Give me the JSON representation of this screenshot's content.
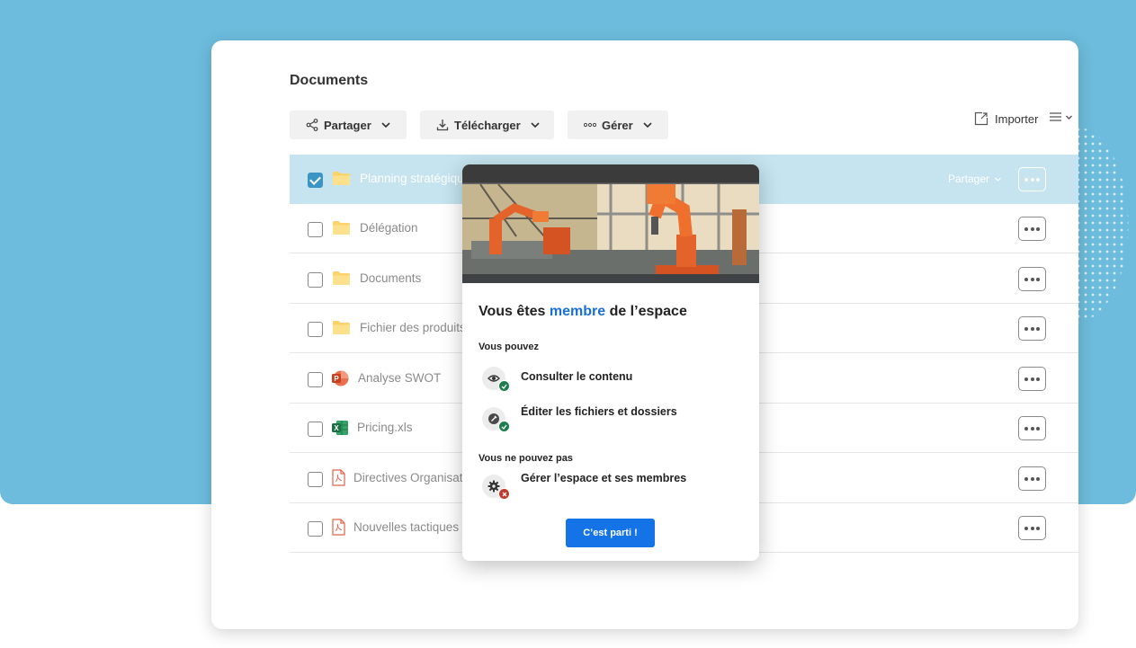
{
  "page": {
    "title": "Documents"
  },
  "toolbar": {
    "share_label": "Partager",
    "download_label": "Télécharger",
    "manage_label": "Gérer",
    "import_label": "Importer"
  },
  "files": [
    {
      "name": "Planning stratégique",
      "type": "folder",
      "selected": true,
      "row_action": "Partager"
    },
    {
      "name": "Délégation",
      "type": "folder",
      "selected": false
    },
    {
      "name": "Documents",
      "type": "folder",
      "selected": false
    },
    {
      "name": "Fichier des produits",
      "type": "folder",
      "selected": false
    },
    {
      "name": "Analyse SWOT",
      "type": "powerpoint",
      "selected": false
    },
    {
      "name": "Pricing.xls",
      "type": "excel",
      "selected": false
    },
    {
      "name": "Directives Organisat",
      "type": "pdf",
      "selected": false
    },
    {
      "name": "Nouvelles tactiques",
      "type": "pdf",
      "selected": false
    }
  ],
  "modal": {
    "title_prefix": "Vous êtes",
    "title_accent": "membre",
    "title_suffix": "de l’espace",
    "can_label": "Vous pouvez",
    "can": [
      {
        "label": "Consulter le contenu",
        "icon": "eye-icon",
        "status": "allowed"
      },
      {
        "label": "Éditer les fichiers et dossiers",
        "icon": "pencil-icon",
        "status": "allowed"
      }
    ],
    "cannot_label": "Vous ne pouvez pas",
    "cannot": [
      {
        "label": "Gérer l’espace et ses membres",
        "icon": "gear-icon",
        "status": "denied"
      }
    ],
    "cta_label": "C’est parti !"
  },
  "colors": {
    "background": "#6dbcdd",
    "selected_row": "#c5e4ef",
    "accent": "#1a6fd6",
    "cta": "#1473e6",
    "allowed": "#1e7d4a",
    "denied": "#c0392b"
  }
}
